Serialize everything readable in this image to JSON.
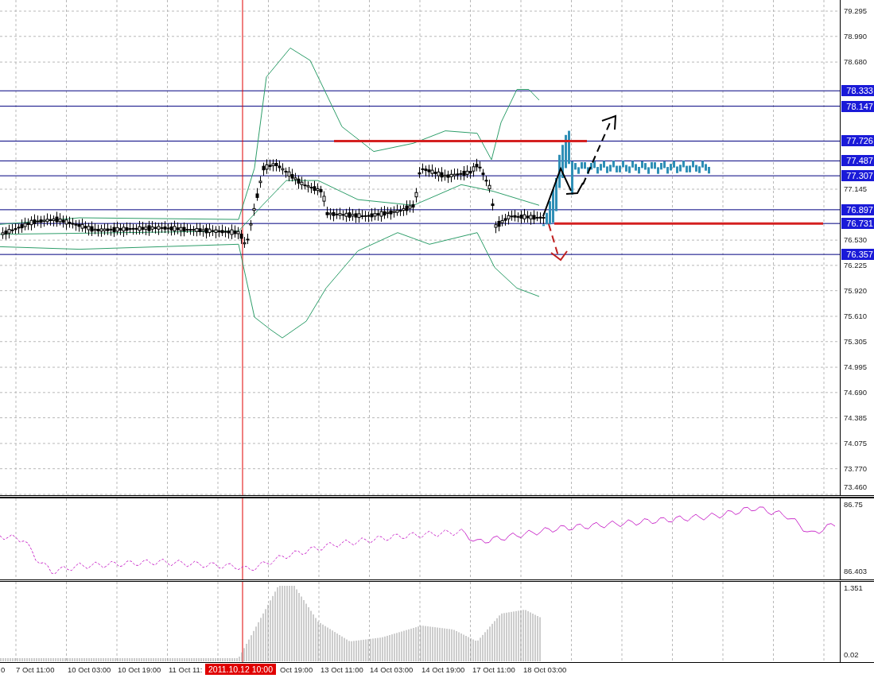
{
  "price_axis": {
    "ticks": [
      "79.295",
      "78.990",
      "78.680",
      "77.145",
      "76.530",
      "76.225",
      "75.920",
      "75.610",
      "75.305",
      "74.995",
      "74.690",
      "74.385",
      "74.075",
      "73.770",
      "73.460"
    ]
  },
  "levels": [
    {
      "label": "78.333"
    },
    {
      "label": "78.147"
    },
    {
      "label": "77.726"
    },
    {
      "label": "77.487"
    },
    {
      "label": "77.307"
    },
    {
      "label": "76.897"
    },
    {
      "label": "76.731"
    },
    {
      "label": "76.357"
    }
  ],
  "indicator_panel": {
    "max_label": "86.75",
    "min_label": "86.403"
  },
  "volume_panel": {
    "max_label": "1.351",
    "min_label": "0.02"
  },
  "time_axis": {
    "labels": [
      "0",
      "7 Oct 11:00",
      "10 Oct 03:00",
      "10 Oct 19:00",
      "11 Oct 11:",
      "Oct 19:00",
      "13 Oct 11:00",
      "14 Oct 03:00",
      "14 Oct 19:00",
      "17 Oct 11:00",
      "18 Oct 03:00"
    ],
    "cursor_label": "2011.10.12 10:00"
  }
}
